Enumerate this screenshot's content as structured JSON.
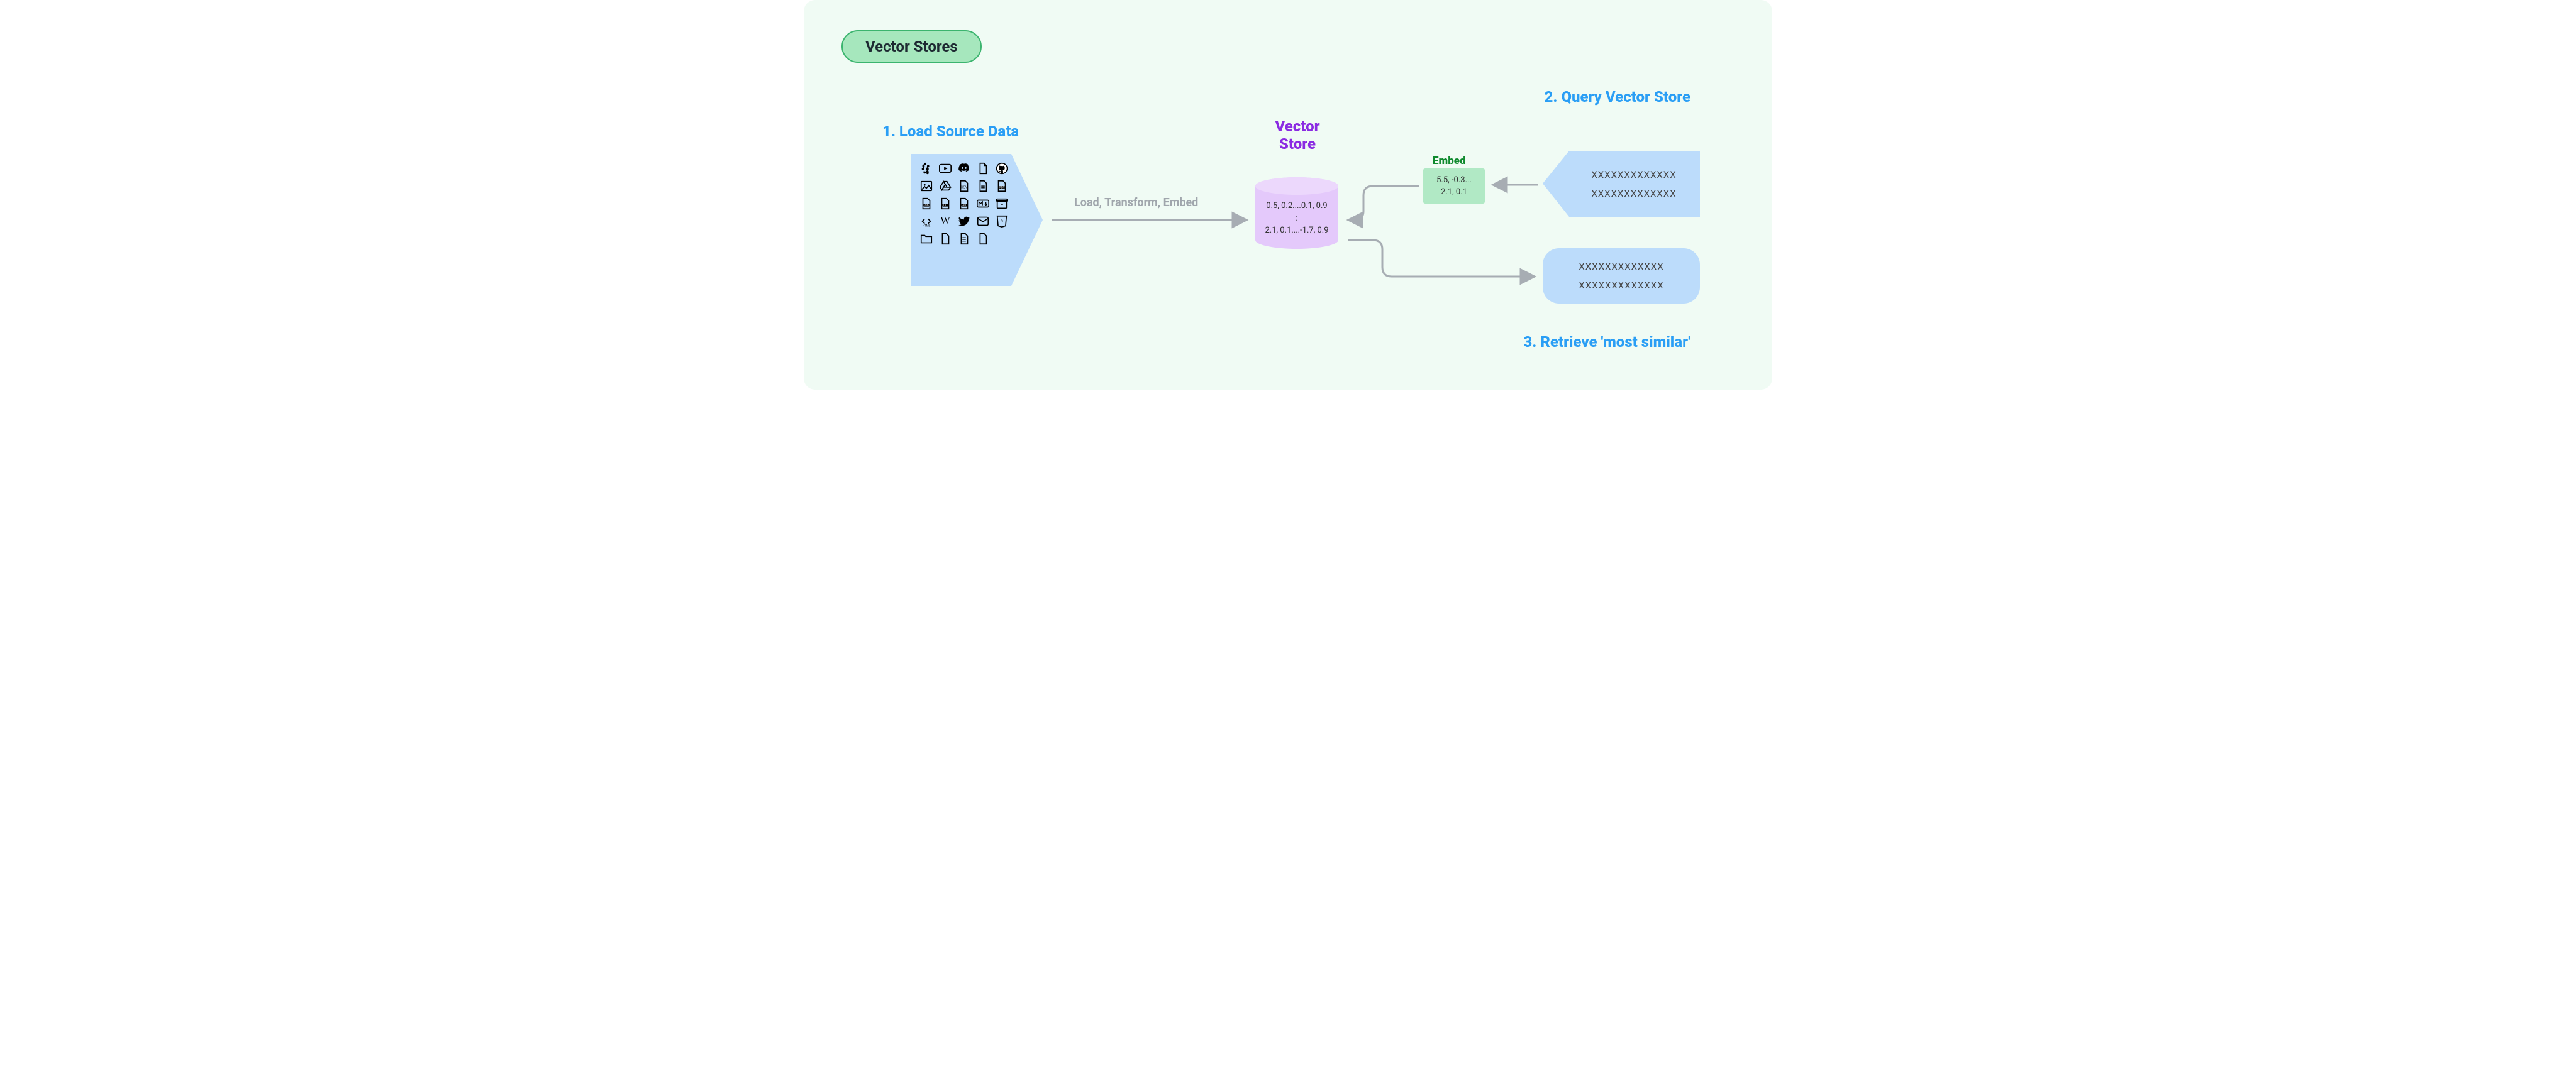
{
  "title": "Vector Stores",
  "steps": {
    "s1": "1.  Load Source Data",
    "s2": "2.  Query Vector Store",
    "s3": "3.  Retrieve 'most similar'"
  },
  "vector_store": {
    "label_line1": "Vector",
    "label_line2": "Store",
    "row1": "0.5, 0.2....0.1, 0.9",
    "separator": ":",
    "row2": "2.1, 0.1....-1.7, 0.9"
  },
  "embed": {
    "label": "Embed",
    "line1": "5.5, -0.3...",
    "line2": "2.1, 0.1"
  },
  "edge_label": "Load, Transform, Embed",
  "query_box": {
    "line1": "XXXXXXXXXXXXX",
    "line2": "XXXXXXXXXXXXX"
  },
  "result_box": {
    "line1": "XXXXXXXXXXXXX",
    "line2": "XXXXXXXXXXXXX"
  },
  "source_icons": [
    "slack-icon",
    "youtube-icon",
    "discord-icon",
    "file-icon",
    "github-icon",
    "image-icon",
    "gdrive-icon",
    "csv-icon",
    "file-icon",
    "pdf-icon",
    "doc-icon",
    "txt-icon",
    "ppt-icon",
    "markdown-icon",
    "archive-icon",
    "html-icon",
    "wikipedia-icon",
    "twitter-icon",
    "mail-icon",
    "css3-icon",
    "folder-icon",
    "file-icon",
    "document-icon",
    "file-icon"
  ]
}
